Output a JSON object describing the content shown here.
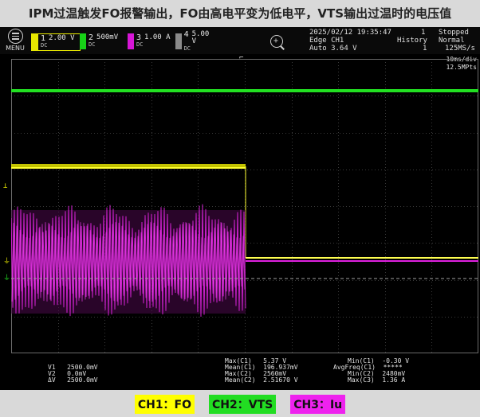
{
  "headline": "IPM过温触发FO报警输出，FO由高电平变为低电平，VTS输出过温时的电压值",
  "menu": {
    "label": "MENU"
  },
  "channels": [
    {
      "num": "1",
      "scale": "2.00 V",
      "coupling": "DC",
      "color": "#e8e800"
    },
    {
      "num": "2",
      "scale": "500mV",
      "coupling": "DC",
      "color": "#17d217"
    },
    {
      "num": "3",
      "scale": "1.00 A",
      "coupling": "DC",
      "color": "#d616d6"
    },
    {
      "num": "4",
      "scale": "5.00 V",
      "coupling": "DC",
      "color": "#8a8a8a"
    }
  ],
  "status": {
    "datetime": "2025/02/12 19:35:47",
    "trigger_source": "Edge CH1",
    "trigger_mode": "Auto 3.64 V",
    "acq_count": "1",
    "run_state": "Stopped",
    "history_label": "History",
    "history_value": "1",
    "acq_mode": "Normal",
    "sample_rate": "125MS/s"
  },
  "timebase": {
    "div": "10ms/div",
    "record": "12.5MPts"
  },
  "cursor_readout": {
    "v1": "V1   2500.0mV",
    "v2": "V2   0.0mV",
    "dv": "ΔV   2500.0mV"
  },
  "measurements": {
    "col1": [
      "Max(C1)   5.37 V",
      "Mean(C1)  196.937mV",
      "Max(C2)   2560mV",
      "Mean(C2)  2.51670 V"
    ],
    "col2": [
      "Min(C1)  -0.30 V",
      "AvgFreq(C1)  *****",
      "Min(C2)  2480mV",
      "Max(C3)  1.36 A"
    ]
  },
  "legend": [
    {
      "text": "CH1：FO",
      "color": "#ffff00"
    },
    {
      "text": "CH2：VTS",
      "color": "#22dd22"
    },
    {
      "text": "CH3：Iu",
      "color": "#ee22ee"
    }
  ]
}
